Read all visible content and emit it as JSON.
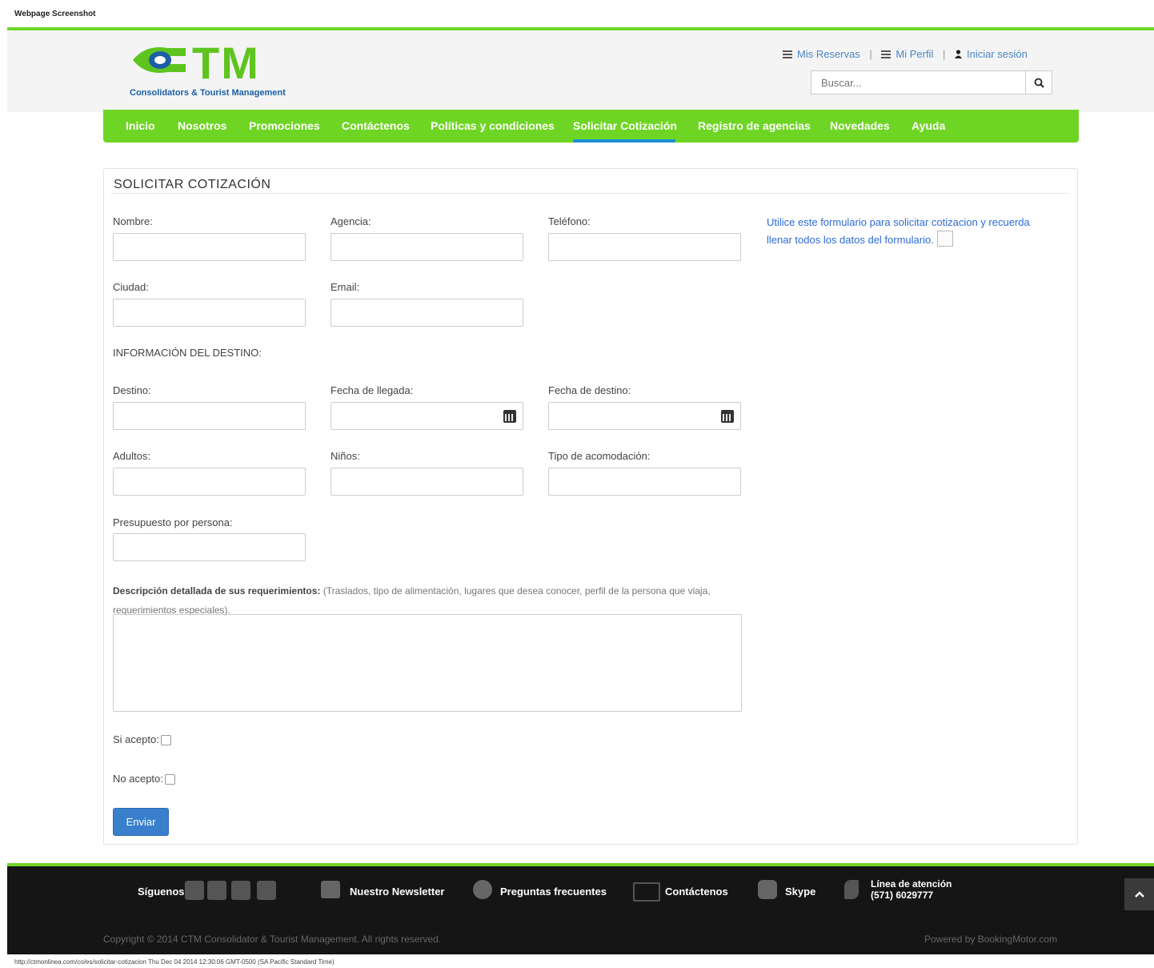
{
  "screenshot_label": "Webpage Screenshot",
  "logo": {
    "main": "TM",
    "sub": "Consolidators & Tourist Management"
  },
  "toplinks": {
    "reservas": "Mis Reservas",
    "perfil": "Mi Perfil",
    "login": "Iniciar sesión"
  },
  "search": {
    "placeholder": "Buscar..."
  },
  "nav": [
    "Inicio",
    "Nosotros",
    "Promociones",
    "Contáctenos",
    "Políticas y condiciones",
    "Solicitar Cotización",
    "Registro de agencias",
    "Novedades",
    "Ayuda"
  ],
  "form": {
    "title": "SOLICITAR COTIZACIÓN",
    "nombre": "Nombre:",
    "agencia": "Agencia:",
    "telefono": "Teléfono:",
    "ciudad": "Ciudad:",
    "email": "Email:",
    "destino_section": "INFORMACIÓN DEL DESTINO:",
    "destino": "Destino:",
    "fecha_llegada": "Fecha de llegada:",
    "fecha_destino": "Fecha de destino:",
    "adultos": "Adultos:",
    "ninos": "Niños:",
    "acomodacion": "Tipo de acomodación:",
    "presupuesto": "Presupuesto por persona:",
    "descripcion_bold": "Descripción detallada de sus requerimientos:",
    "descripcion_note": " (Traslados, tipo de alimentación, lugares que desea conocer, perfil de la persona que viaja, requerimientos especiales).",
    "si_acepto": "Si acepto:",
    "no_acepto": "No acepto:",
    "submit": "Enviar",
    "note": "Utilice este formulario para solicitar cotizacion y recuerda llenar todos los datos del formulario."
  },
  "footer": {
    "siguenos": "Síguenos",
    "newsletter": "Nuestro Newsletter",
    "faq": "Preguntas frecuentes",
    "contact": "Contáctenos",
    "skype": "Skype",
    "linea": "Línea de atención",
    "phone": "(571) 6029777",
    "copyright": "Copyright © 2014 CTM Consolidator & Tourist Management. All rights reserved.",
    "powered": "Powered by BookingMotor.com"
  },
  "frame_footer": "http://ctmonlinea.com/co/es/solicitar-cotizacion Thu Dec 04 2014 12:30:06 GMT-0500 (SA Pacific Standard Time)"
}
